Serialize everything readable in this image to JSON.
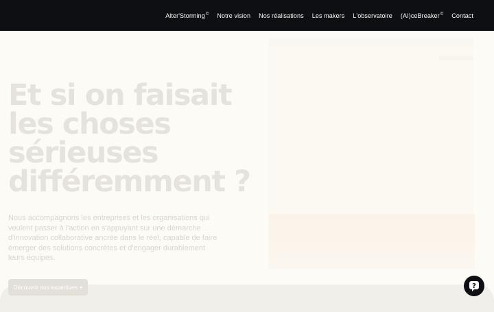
{
  "nav": {
    "items": [
      {
        "label": "Alter'Storming",
        "sup": "©"
      },
      {
        "label": "Notre vision"
      },
      {
        "label": "Nos réalisations"
      },
      {
        "label": "Les makers"
      },
      {
        "label": "L'observatoire"
      },
      {
        "label": "(AI)ceBreaker",
        "sup": "©"
      },
      {
        "label": "Contact"
      }
    ]
  },
  "hero": {
    "title": "Et si on faisait les choses sérieuses différemment ?",
    "text": "Nous accompagnons les entreprises et les organisations qui veulent passer à l'action en s'appuyant sur une démarche d'innovation collaborative ancrée dans le réel, capable de faire émerger des solutions concrètes et d'engager durablement leurs équipes.",
    "cta_label": "Découvrir nos expertises",
    "cta_icon": "chevron-right-icon"
  },
  "help": {
    "icon": "question-mark-icon"
  },
  "colors": {
    "header_bg": "#0e0f12",
    "page_bg": "#fdfbf6",
    "faded_text": "#e6e3dd"
  }
}
